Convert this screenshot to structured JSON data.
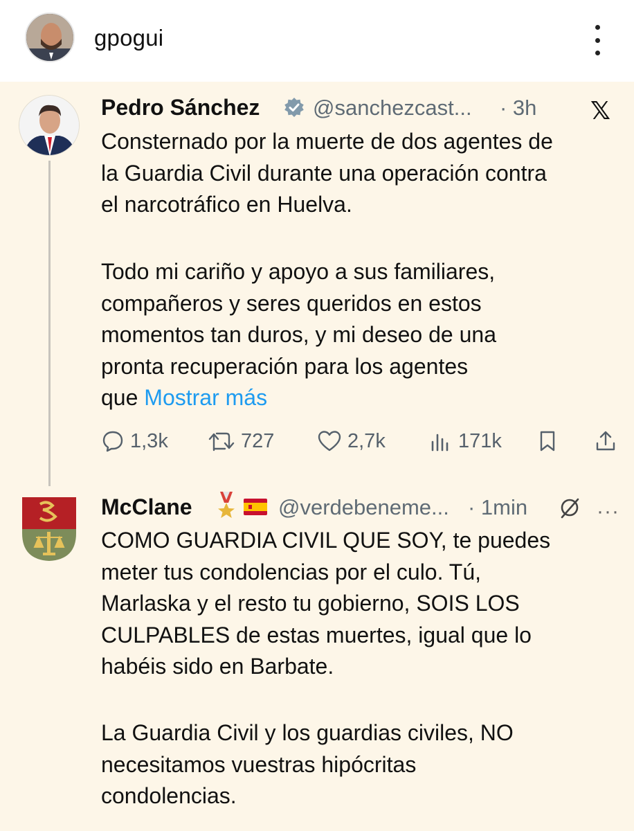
{
  "header": {
    "username": "gpogui",
    "menu_icon": "more-vertical-icon"
  },
  "tweet1": {
    "author_name": "Pedro Sánchez",
    "handle": "@sanchezcast...",
    "time": "· 3h",
    "text_p1": "Consternado por la muerte de dos agentes de\nla Guardia Civil durante una operación contra\nel narcotráfico en Huelva.",
    "text_p2": "Todo mi cariño y apoyo a sus familiares,\ncompañeros y seres queridos en estos\nmomentos tan duros, y mi deseo de una\npronta recuperación para los agentes",
    "text_p2_last": "que",
    "show_more": "Mostrar más",
    "stats": {
      "replies": "1,3k",
      "reposts": "727",
      "likes": "2,7k",
      "views": "171k"
    }
  },
  "tweet2": {
    "author_name": "McClane",
    "handle": "@verdebeneme...",
    "time": "· 1min",
    "text_p1": "COMO GUARDIA CIVIL QUE SOY, te puedes\nmeter tus condolencias por el culo. Tú,\nMarlaska y el resto tu gobierno, SOIS LOS\nCULPABLES de estas muertes, igual que lo\nhabéis sido en Barbate.",
    "text_p2": "La Guardia Civil y los guardias civiles, NO\nnecesitamos vuestras hipócritas\ncondolencias.",
    "more_dots": "···"
  },
  "colors": {
    "background": "#fdf6e8",
    "link": "#1d9bf0",
    "muted": "#5f6b75",
    "verified_gray": "#829aab"
  }
}
